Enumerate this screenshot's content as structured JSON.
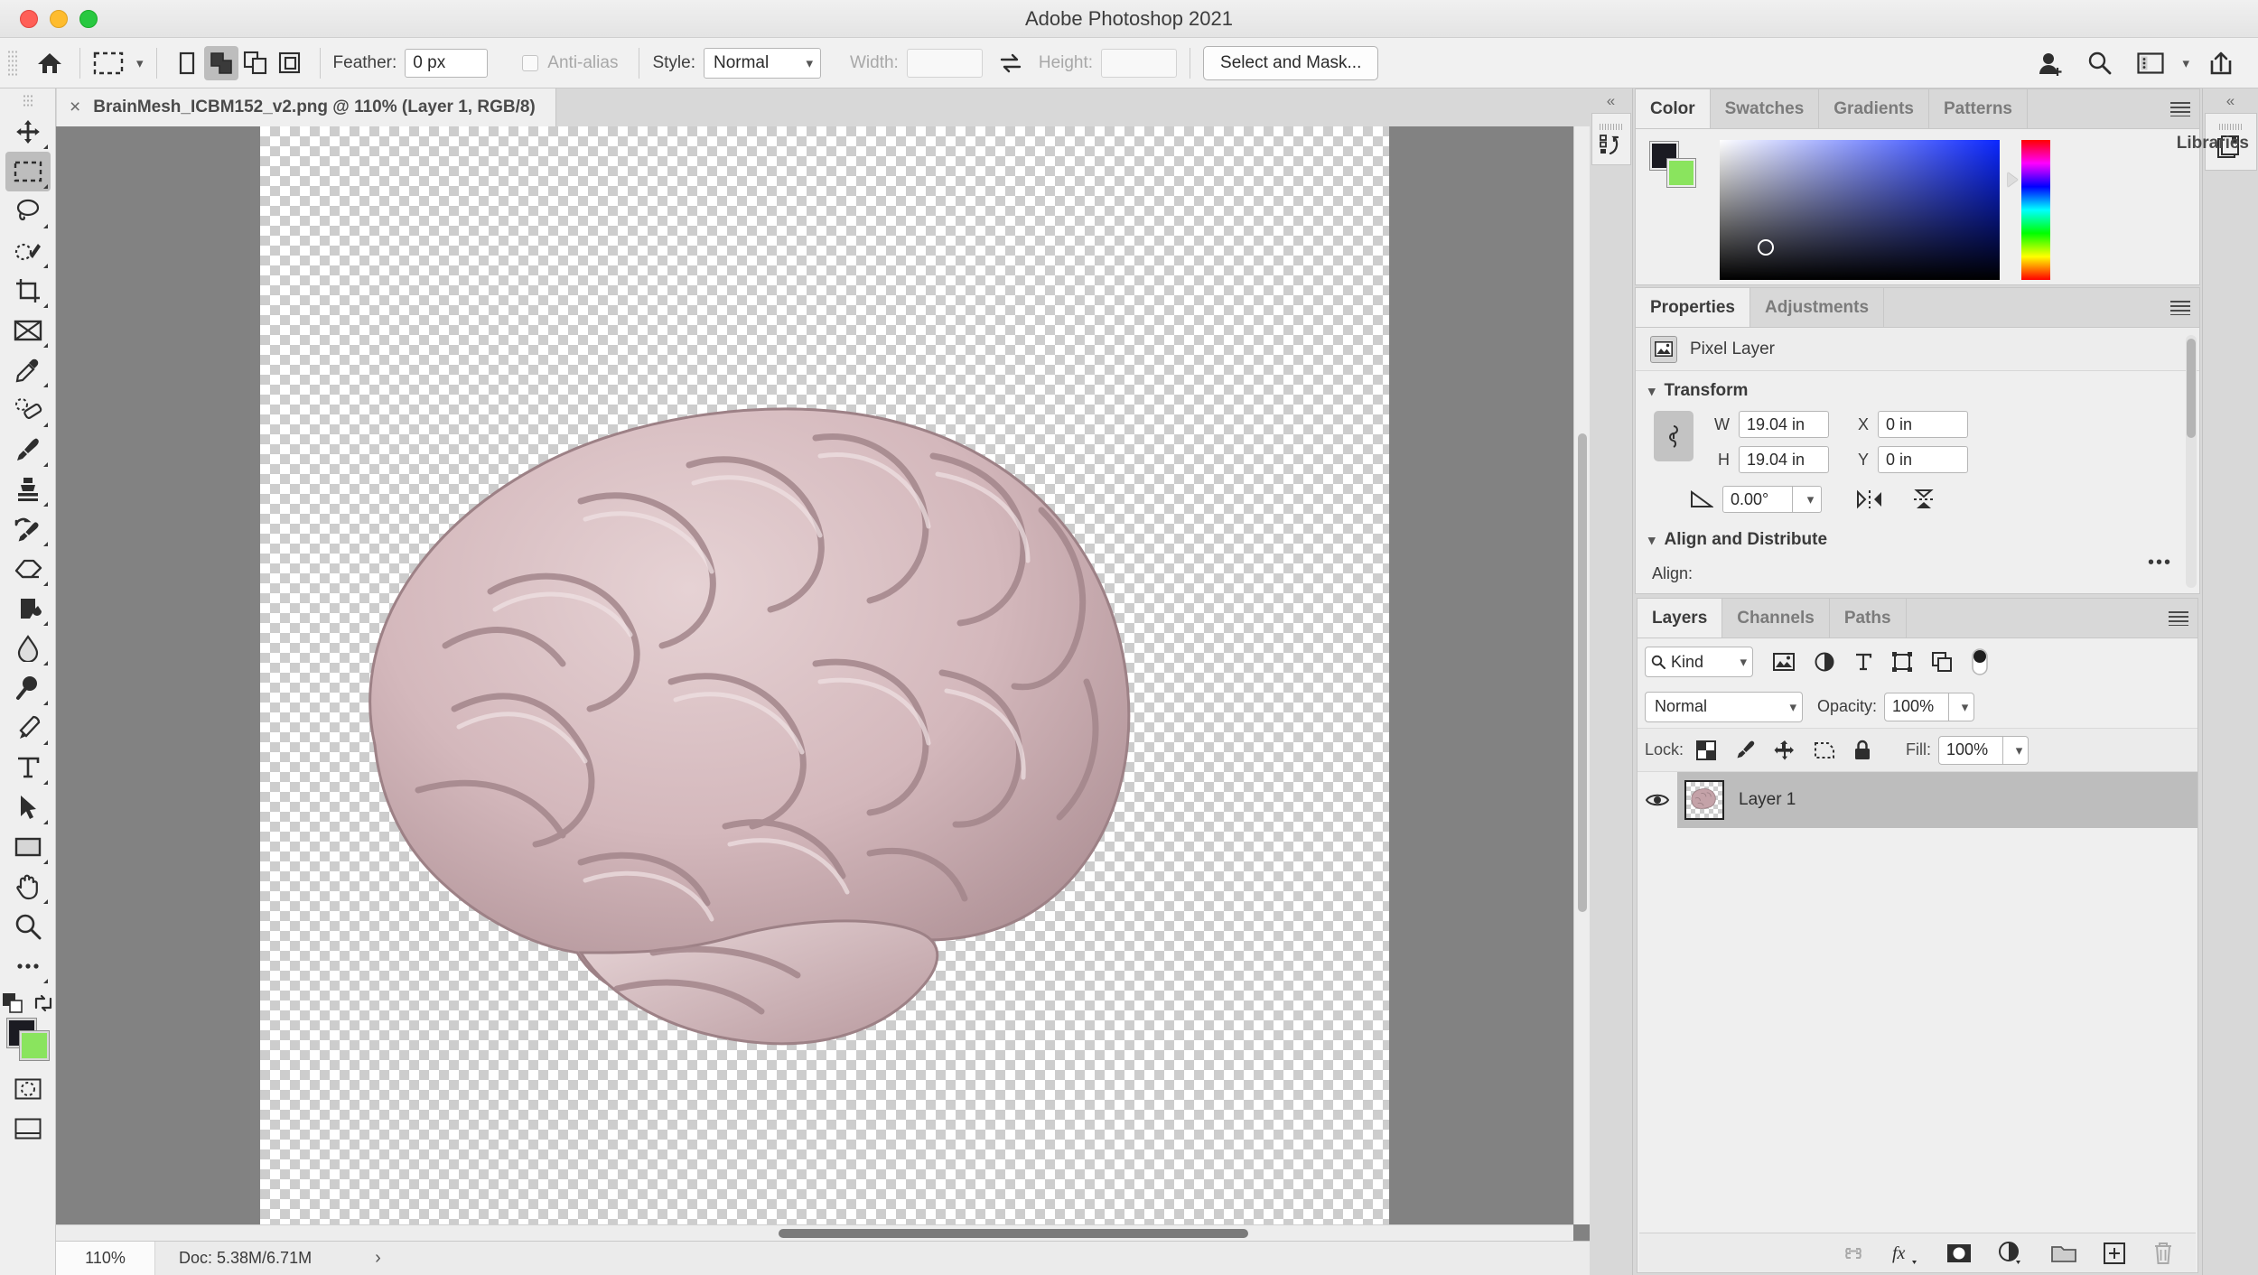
{
  "window": {
    "title": "Adobe Photoshop 2021"
  },
  "options_bar": {
    "home_icon": "home-icon",
    "tool_preset": "marquee-tool-preset",
    "selection_modes": [
      "new-selection",
      "add-to-selection",
      "subtract-from-selection",
      "intersect-with-selection"
    ],
    "active_selection_mode": 1,
    "feather_label": "Feather:",
    "feather_value": "0 px",
    "antialias_label": "Anti-alias",
    "antialias_checked": false,
    "style_label": "Style:",
    "style_value": "Normal",
    "width_label": "Width:",
    "width_value": "",
    "height_label": "Height:",
    "height_value": "",
    "swap_icon": "swap-width-height-icon",
    "select_and_mask": "Select and Mask...",
    "right_icons": [
      "add-user-icon",
      "search-icon",
      "workspace-icon",
      "chevron-down-icon",
      "share-icon"
    ]
  },
  "document_tab": {
    "close": "×",
    "title": "BrainMesh_ICBM152_v2.png @ 110% (Layer 1, RGB/8)"
  },
  "toolbar": {
    "tools": [
      {
        "name": "move-tool",
        "label": "Move"
      },
      {
        "name": "rectangular-marquee-tool",
        "label": "Rectangular Marquee",
        "selected": true
      },
      {
        "name": "lasso-tool",
        "label": "Lasso"
      },
      {
        "name": "object-selection-tool",
        "label": "Object Selection"
      },
      {
        "name": "crop-tool",
        "label": "Crop"
      },
      {
        "name": "frame-tool",
        "label": "Frame"
      },
      {
        "name": "eyedropper-tool",
        "label": "Eyedropper"
      },
      {
        "name": "spot-healing-brush-tool",
        "label": "Spot Healing Brush"
      },
      {
        "name": "brush-tool",
        "label": "Brush"
      },
      {
        "name": "clone-stamp-tool",
        "label": "Clone Stamp"
      },
      {
        "name": "history-brush-tool",
        "label": "History Brush"
      },
      {
        "name": "eraser-tool",
        "label": "Eraser"
      },
      {
        "name": "gradient-tool",
        "label": "Gradient"
      },
      {
        "name": "blur-tool",
        "label": "Blur"
      },
      {
        "name": "dodge-tool",
        "label": "Dodge"
      },
      {
        "name": "pen-tool",
        "label": "Pen"
      },
      {
        "name": "type-tool",
        "label": "Horizontal Type"
      },
      {
        "name": "path-selection-tool",
        "label": "Path Selection"
      },
      {
        "name": "rectangle-tool",
        "label": "Rectangle"
      },
      {
        "name": "hand-tool",
        "label": "Hand"
      },
      {
        "name": "zoom-tool",
        "label": "Zoom"
      },
      {
        "name": "edit-toolbar-tool",
        "label": "Edit Toolbar"
      }
    ],
    "foreground_color": "#1b1b22",
    "background_color": "#8ae45e",
    "quick_mask": "quick-mask-mode",
    "screen_mode": "screen-mode"
  },
  "canvas": {
    "zoom": "110%"
  },
  "status_bar": {
    "zoom": "110%",
    "doc": "Doc: 5.38M/6.71M",
    "arrow": "›"
  },
  "color_panel": {
    "tabs": [
      "Color",
      "Swatches",
      "Gradients",
      "Patterns"
    ],
    "active_tab": "Color",
    "foreground": "#1b1b22",
    "background": "#8ae45e",
    "menu_icon": "panel-menu-icon"
  },
  "properties_panel": {
    "tabs": [
      "Properties",
      "Adjustments"
    ],
    "active_tab": "Properties",
    "layer_kind": "Pixel Layer",
    "transform": {
      "title": "Transform",
      "link_icon": "link-wh-icon",
      "w_label": "W",
      "w_value": "19.04 in",
      "h_label": "H",
      "h_value": "19.04 in",
      "x_label": "X",
      "x_value": "0 in",
      "y_label": "Y",
      "y_value": "0 in",
      "angle_icon": "angle-icon",
      "angle_value": "0.00°",
      "flip_horizontal_icon": "flip-horizontal-icon",
      "flip_vertical_icon": "flip-vertical-icon"
    },
    "align": {
      "title": "Align and Distribute",
      "label": "Align:",
      "buttons": [
        "align-left-edges-icon",
        "align-horizontal-centers-icon",
        "align-right-edges-icon",
        "align-top-edges-icon",
        "align-vertical-centers-icon",
        "align-bottom-edges-icon"
      ],
      "more": "•••"
    }
  },
  "layers_panel": {
    "tabs": [
      "Layers",
      "Channels",
      "Paths"
    ],
    "active_tab": "Layers",
    "filter_label": "Kind",
    "filter_icons": [
      "filter-pixel-icon",
      "filter-adjustment-icon",
      "filter-type-icon",
      "filter-shape-icon",
      "filter-smart-object-icon"
    ],
    "filter_toggle": "filter-toggle-switch",
    "blend_mode": "Normal",
    "opacity_label": "Opacity:",
    "opacity_value": "100%",
    "lock_label": "Lock:",
    "lock_icons": [
      "lock-transparent-pixels-icon",
      "lock-image-pixels-icon",
      "lock-position-icon",
      "lock-artboard-icon",
      "lock-all-icon"
    ],
    "fill_label": "Fill:",
    "fill_value": "100%",
    "layers": [
      {
        "name": "Layer 1",
        "visible": true,
        "selected": true
      }
    ],
    "footer_icons": [
      "link-layers-icon",
      "layer-style-fx-icon",
      "add-layer-mask-icon",
      "new-fill-adjustment-layer-icon",
      "new-group-icon",
      "new-layer-icon",
      "delete-layer-icon"
    ]
  },
  "libraries_panel": {
    "label": "Libraries",
    "icon": "libraries-icon",
    "collapse": "«"
  },
  "history_rail": {
    "icon": "history-icon",
    "collapse": "«"
  }
}
